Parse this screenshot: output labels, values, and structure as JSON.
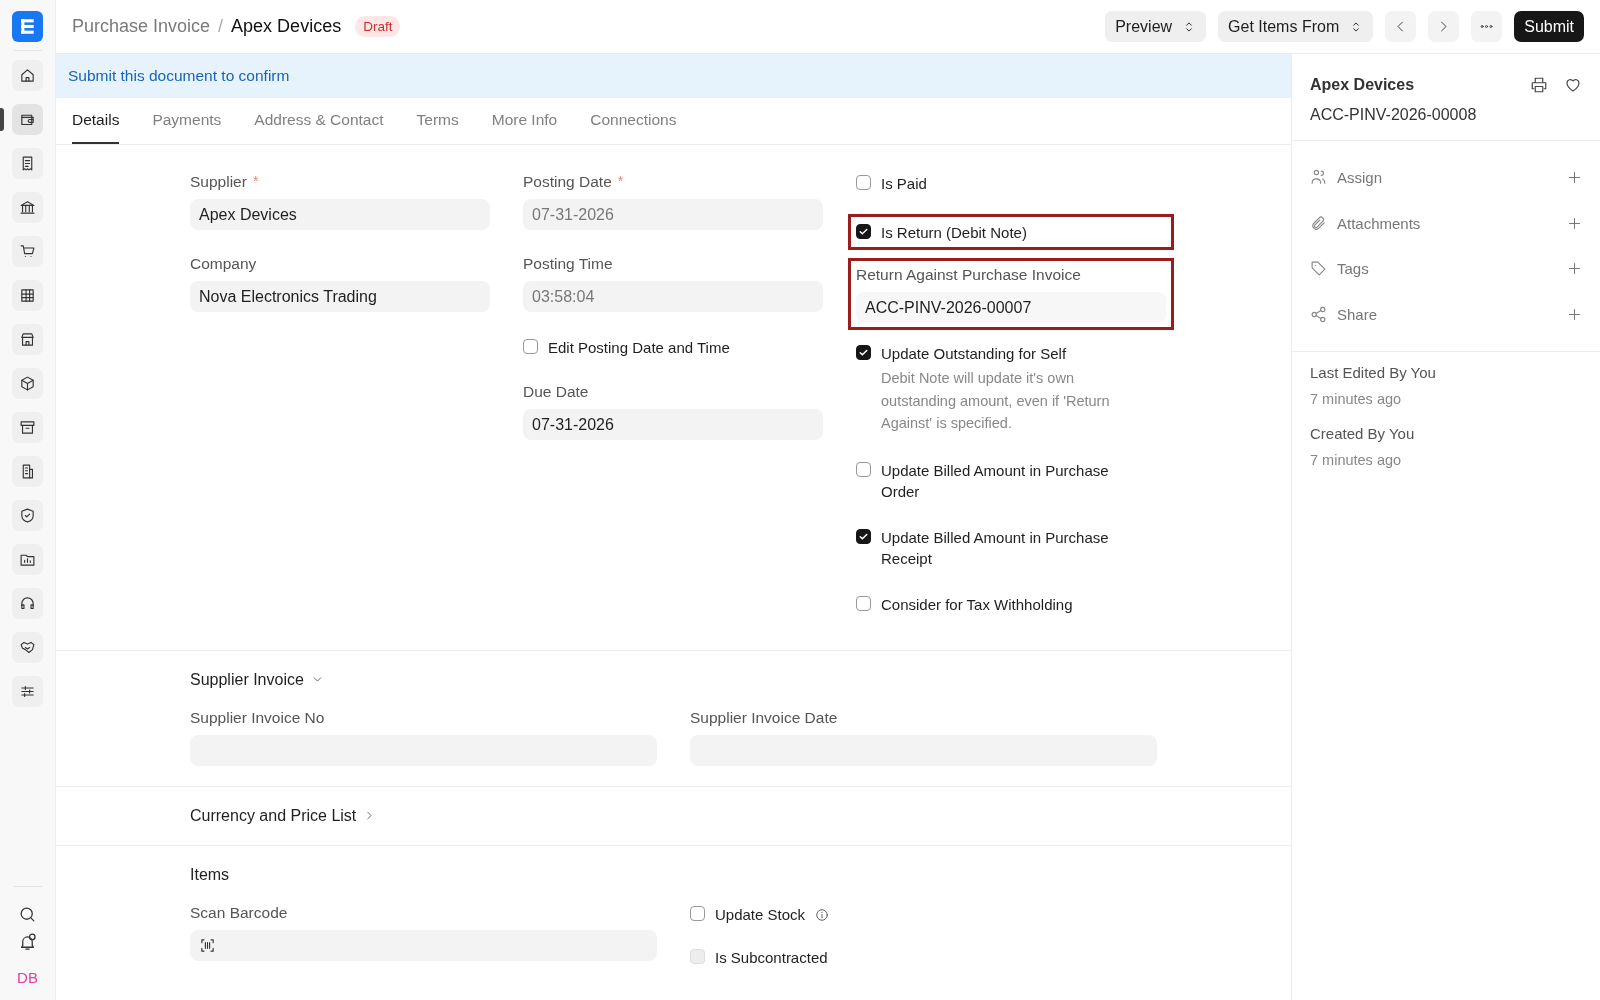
{
  "sidebar": {
    "items": [
      {
        "kind": "home",
        "selected": false
      },
      {
        "kind": "wallet",
        "selected": true
      },
      {
        "kind": "receipt",
        "selected": false
      },
      {
        "kind": "bank",
        "selected": false
      },
      {
        "kind": "cart",
        "selected": false
      },
      {
        "kind": "table",
        "selected": false
      },
      {
        "kind": "store",
        "selected": false
      },
      {
        "kind": "box",
        "selected": false
      },
      {
        "kind": "archive",
        "selected": false
      },
      {
        "kind": "building",
        "selected": false
      },
      {
        "kind": "shield",
        "selected": false
      },
      {
        "kind": "folder",
        "selected": false
      },
      {
        "kind": "headset",
        "selected": false
      },
      {
        "kind": "handshake",
        "selected": false
      },
      {
        "kind": "sliders",
        "selected": false
      }
    ],
    "footer": {
      "notifications_unread": true,
      "avatar": "DB"
    }
  },
  "breadcrumb": {
    "parent": "Purchase Invoice",
    "separator": "/",
    "current": "Apex Devices",
    "status": "Draft"
  },
  "toolbar": [
    {
      "kind": "dropdown",
      "label": "Preview"
    },
    {
      "kind": "dropdown",
      "label": "Get Items From"
    },
    {
      "kind": "prev"
    },
    {
      "kind": "next"
    },
    {
      "kind": "more"
    },
    {
      "kind": "primary",
      "label": "Submit"
    }
  ],
  "banner": "Submit this document to confirm",
  "tabs": [
    {
      "label": "Details",
      "selected": true
    },
    {
      "label": "Payments",
      "selected": false
    },
    {
      "label": "Address & Contact",
      "selected": false
    },
    {
      "label": "Terms",
      "selected": false
    },
    {
      "label": "More Info",
      "selected": false
    },
    {
      "label": "Connections",
      "selected": false
    }
  ],
  "form": {
    "columns": [
      {
        "fields": [
          {
            "kind": "field",
            "label": "Supplier",
            "required_mark": "*",
            "value": "Apex Devices",
            "readonly": false
          },
          {
            "kind": "field",
            "label": "Company",
            "value": "Nova Electronics Trading",
            "readonly": false
          }
        ]
      },
      {
        "fields": [
          {
            "kind": "field",
            "label": "Posting Date",
            "required_mark": "*",
            "value": "07-31-2026",
            "readonly": true
          },
          {
            "kind": "field",
            "label": "Posting Time",
            "value": "03:58:04",
            "readonly": true
          },
          {
            "kind": "checkbox",
            "label": "Edit Posting Date and Time",
            "checked": false
          },
          {
            "kind": "field",
            "label": "Due Date",
            "value": "07-31-2026",
            "readonly": false
          }
        ]
      },
      {
        "fields": [
          {
            "kind": "checkbox",
            "label": "Is Paid",
            "checked": false,
            "highlighted": false
          },
          {
            "kind": "checkbox",
            "label": "Is Return (Debit Note)",
            "checked": true,
            "highlighted": true
          },
          {
            "kind": "field",
            "label": "Return Against Purchase Invoice",
            "value": "ACC-PINV-2026-00007",
            "readonly": false,
            "highlighted": true
          },
          {
            "kind": "checkbox",
            "label": "Update Outstanding for Self",
            "checked": true,
            "highlighted": false,
            "description": "Debit Note will update it's own outstanding amount, even if 'Return Against' is specified."
          },
          {
            "kind": "checkbox",
            "label": "Update Billed Amount in Purchase Order",
            "checked": false,
            "highlighted": false
          },
          {
            "kind": "checkbox",
            "label": "Update Billed Amount in Purchase Receipt",
            "checked": true,
            "highlighted": false
          },
          {
            "kind": "checkbox",
            "label": "Consider for Tax Withholding",
            "checked": false,
            "highlighted": false
          }
        ]
      }
    ]
  },
  "sections": [
    {
      "title": "Supplier Invoice",
      "kind": "collapsible",
      "expanded": true,
      "columns": [
        {
          "fields": [
            {
              "kind": "field",
              "label": "Supplier Invoice No",
              "readonly": false
            }
          ]
        },
        {
          "fields": [
            {
              "kind": "field",
              "label": "Supplier Invoice Date",
              "readonly": false
            }
          ]
        }
      ]
    },
    {
      "title": "Currency and Price List",
      "kind": "collapsible",
      "expanded": false
    },
    {
      "title": "Items",
      "kind": "plain",
      "columns": [
        {
          "fields": [
            {
              "kind": "scan",
              "label": "Scan Barcode"
            }
          ]
        },
        {
          "fields": [
            {
              "kind": "checkbox",
              "label": "Update Stock",
              "checked": false,
              "disabled": false,
              "info": true
            },
            {
              "kind": "checkbox",
              "label": "Is Subcontracted",
              "checked": false,
              "disabled": true,
              "info": false
            }
          ]
        }
      ]
    }
  ],
  "sidebar_panel": {
    "title": "Apex Devices",
    "name": "ACC-PINV-2026-00008",
    "actions": [
      {
        "kind": "assign",
        "label": "Assign"
      },
      {
        "kind": "attachments",
        "label": "Attachments"
      },
      {
        "kind": "tags",
        "label": "Tags"
      },
      {
        "kind": "share",
        "label": "Share"
      }
    ],
    "meta": [
      {
        "label": "Last Edited By You",
        "time": "7 minutes ago"
      },
      {
        "label": "Created By You",
        "time": "7 minutes ago"
      }
    ]
  }
}
